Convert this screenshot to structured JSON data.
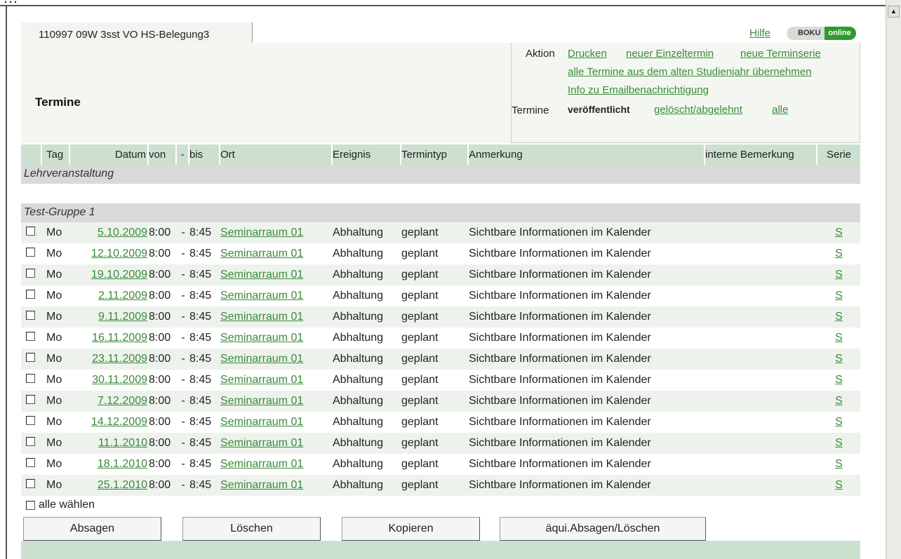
{
  "window": {
    "title_fragment": "…"
  },
  "tab": {
    "label": "110997 09W 3sst VO HS-Belegung3"
  },
  "topbar": {
    "help": "Hilfe",
    "logo_a": "BOKU",
    "logo_b": "online"
  },
  "page": {
    "title": "Termine"
  },
  "actions": {
    "aktion_label": "Aktion",
    "drucken": "Drucken",
    "neuer_einzeltermin": "neuer Einzeltermin",
    "neue_terminserie": "neue Terminserie",
    "alte_termine": "alle Termine aus dem alten Studienjahr übernehmen",
    "info_email": "Info zu Emailbenachrichtigung",
    "termine_label": "Termine",
    "veroeffentlicht": "veröffentlicht",
    "geloescht": "gelöscht/abgelehnt",
    "alle": "alle"
  },
  "table": {
    "headers": [
      "Tag",
      "Datum",
      "von",
      "-",
      "bis",
      "Ort",
      "Ereignis",
      "Termintyp",
      "Anmerkung",
      "interne Bemerkung",
      "Serie"
    ],
    "section_title": "Lehrveranstaltung",
    "group_title": "Test-Gruppe 1",
    "rows": [
      {
        "tag": "Mo",
        "datum": "5.10.2009",
        "von": "8:00",
        "sep": "-",
        "bis": "8:45",
        "ort": "Seminarraum 01",
        "ereignis": "Abhaltung",
        "typ": "geplant",
        "anmerkung": "Sichtbare Informationen im Kalender",
        "serie": "S"
      },
      {
        "tag": "Mo",
        "datum": "12.10.2009",
        "von": "8:00",
        "sep": "-",
        "bis": "8:45",
        "ort": "Seminarraum 01",
        "ereignis": "Abhaltung",
        "typ": "geplant",
        "anmerkung": "Sichtbare Informationen im Kalender",
        "serie": "S"
      },
      {
        "tag": "Mo",
        "datum": "19.10.2009",
        "von": "8:00",
        "sep": "-",
        "bis": "8:45",
        "ort": "Seminarraum 01",
        "ereignis": "Abhaltung",
        "typ": "geplant",
        "anmerkung": "Sichtbare Informationen im Kalender",
        "serie": "S"
      },
      {
        "tag": "Mo",
        "datum": "2.11.2009",
        "von": "8:00",
        "sep": "-",
        "bis": "8:45",
        "ort": "Seminarraum 01",
        "ereignis": "Abhaltung",
        "typ": "geplant",
        "anmerkung": "Sichtbare Informationen im Kalender",
        "serie": "S"
      },
      {
        "tag": "Mo",
        "datum": "9.11.2009",
        "von": "8:00",
        "sep": "-",
        "bis": "8:45",
        "ort": "Seminarraum 01",
        "ereignis": "Abhaltung",
        "typ": "geplant",
        "anmerkung": "Sichtbare Informationen im Kalender",
        "serie": "S"
      },
      {
        "tag": "Mo",
        "datum": "16.11.2009",
        "von": "8:00",
        "sep": "-",
        "bis": "8:45",
        "ort": "Seminarraum 01",
        "ereignis": "Abhaltung",
        "typ": "geplant",
        "anmerkung": "Sichtbare Informationen im Kalender",
        "serie": "S"
      },
      {
        "tag": "Mo",
        "datum": "23.11.2009",
        "von": "8:00",
        "sep": "-",
        "bis": "8:45",
        "ort": "Seminarraum 01",
        "ereignis": "Abhaltung",
        "typ": "geplant",
        "anmerkung": "Sichtbare Informationen im Kalender",
        "serie": "S"
      },
      {
        "tag": "Mo",
        "datum": "30.11.2009",
        "von": "8:00",
        "sep": "-",
        "bis": "8:45",
        "ort": "Seminarraum 01",
        "ereignis": "Abhaltung",
        "typ": "geplant",
        "anmerkung": "Sichtbare Informationen im Kalender",
        "serie": "S"
      },
      {
        "tag": "Mo",
        "datum": "7.12.2009",
        "von": "8:00",
        "sep": "-",
        "bis": "8:45",
        "ort": "Seminarraum 01",
        "ereignis": "Abhaltung",
        "typ": "geplant",
        "anmerkung": "Sichtbare Informationen im Kalender",
        "serie": "S"
      },
      {
        "tag": "Mo",
        "datum": "14.12.2009",
        "von": "8:00",
        "sep": "-",
        "bis": "8:45",
        "ort": "Seminarraum 01",
        "ereignis": "Abhaltung",
        "typ": "geplant",
        "anmerkung": "Sichtbare Informationen im Kalender",
        "serie": "S"
      },
      {
        "tag": "Mo",
        "datum": "11.1.2010",
        "von": "8:00",
        "sep": "-",
        "bis": "8:45",
        "ort": "Seminarraum 01",
        "ereignis": "Abhaltung",
        "typ": "geplant",
        "anmerkung": "Sichtbare Informationen im Kalender",
        "serie": "S"
      },
      {
        "tag": "Mo",
        "datum": "18.1.2010",
        "von": "8:00",
        "sep": "-",
        "bis": "8:45",
        "ort": "Seminarraum 01",
        "ereignis": "Abhaltung",
        "typ": "geplant",
        "anmerkung": "Sichtbare Informationen im Kalender",
        "serie": "S"
      },
      {
        "tag": "Mo",
        "datum": "25.1.2010",
        "von": "8:00",
        "sep": "-",
        "bis": "8:45",
        "ort": "Seminarraum 01",
        "ereignis": "Abhaltung",
        "typ": "geplant",
        "anmerkung": "Sichtbare Informationen im Kalender",
        "serie": "S"
      }
    ],
    "select_all": "alle wählen"
  },
  "buttons": {
    "absagen": "Absagen",
    "loeschen": "Löschen",
    "kopieren": "Kopieren",
    "aequi": "äqui.Absagen/Löschen"
  },
  "colors": {
    "accent_green": "#3a8a3a",
    "header_green": "#cce0cf",
    "row_alt": "#edf3ec",
    "logo_green": "#2e9a2e"
  },
  "icons": {
    "scroll_up": "scroll-up-arrow-icon",
    "checkbox": "checkbox-icon"
  }
}
